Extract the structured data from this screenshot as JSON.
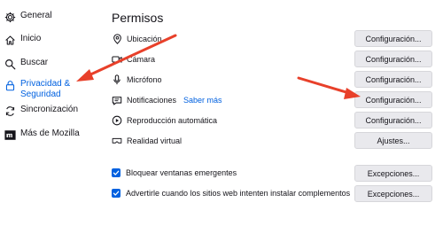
{
  "sidebar": {
    "items": [
      {
        "label": "General",
        "icon": "gear-icon"
      },
      {
        "label": "Inicio",
        "icon": "home-icon"
      },
      {
        "label": "Buscar",
        "icon": "search-icon"
      },
      {
        "label": "Privacidad &\nSeguridad",
        "icon": "lock-icon",
        "active": true
      },
      {
        "label": "Sincronización",
        "icon": "sync-icon"
      },
      {
        "label": "Más de Mozilla",
        "icon": "mozilla-icon"
      }
    ]
  },
  "permissions": {
    "title": "Permisos",
    "rows": [
      {
        "label": "Ubicación",
        "icon": "location-icon",
        "button": "Configuración..."
      },
      {
        "label": "Cámara",
        "icon": "camera-icon",
        "button": "Configuración..."
      },
      {
        "label": "Micrófono",
        "icon": "microphone-icon",
        "button": "Configuración..."
      },
      {
        "label": "Notificaciones",
        "icon": "notification-icon",
        "button": "Configuración...",
        "link": "Saber más"
      },
      {
        "label": "Reproducción automática",
        "icon": "autoplay-icon",
        "button": "Configuración..."
      },
      {
        "label": "Realidad virtual",
        "icon": "vr-icon",
        "button": "Ajustes..."
      }
    ],
    "checks": [
      {
        "label": "Bloquear ventanas emergentes",
        "checked": true,
        "button": "Excepciones..."
      },
      {
        "label": "Advertirle cuando los sitios web intenten instalar complementos",
        "checked": true,
        "button": "Excepciones..."
      }
    ]
  },
  "colors": {
    "accent": "#0061e0",
    "arrow": "#e8402a",
    "button_bg": "#e9e9ed"
  }
}
